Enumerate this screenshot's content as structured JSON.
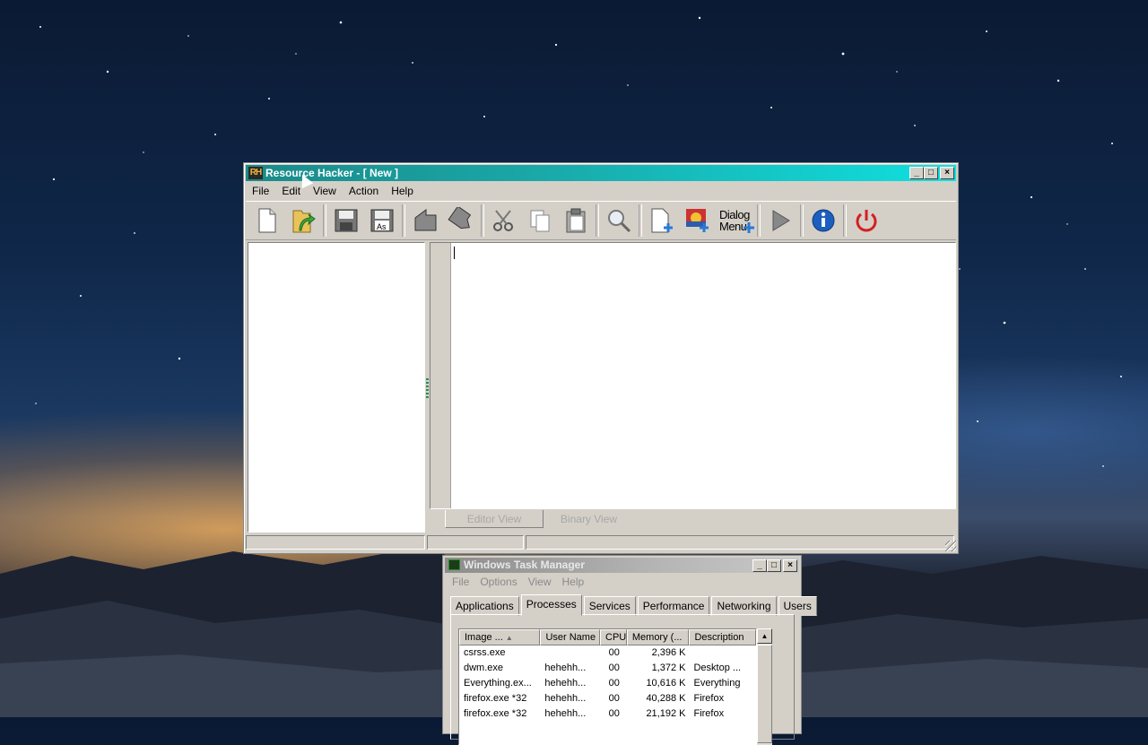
{
  "rh_window": {
    "app_icon_text": "RH",
    "title": "Resource Hacker - [ New ]",
    "window_buttons": {
      "minimize": "_",
      "maximize": "□",
      "close": "×"
    },
    "menu": [
      "File",
      "Edit",
      "View",
      "Action",
      "Help"
    ],
    "toolbar_icons": [
      "new-file-icon",
      "open-folder-icon",
      "save-icon",
      "save-as-icon",
      "compile-icon",
      "go-to-icon",
      "cut-icon",
      "copy-icon",
      "paste-icon",
      "find-icon",
      "add-resource-icon",
      "add-image-icon",
      "dialog-menu-icon",
      "run-script-icon",
      "about-icon",
      "exit-icon"
    ],
    "toolbar_texts": {
      "save_as": "As",
      "dialog": "Dialog",
      "menu": "Menu"
    },
    "tabs": {
      "editor_view": "Editor View",
      "binary_view": "Binary View"
    }
  },
  "task_manager": {
    "title": "Windows Task Manager",
    "window_buttons": {
      "minimize": "_",
      "maximize": "□",
      "close": "×"
    },
    "menu": [
      "File",
      "Options",
      "View",
      "Help"
    ],
    "tabs": [
      "Applications",
      "Processes",
      "Services",
      "Performance",
      "Networking",
      "Users"
    ],
    "active_tab": "Processes",
    "columns": [
      "Image ...",
      "User Name",
      "CPU",
      "Memory (...",
      "Description"
    ],
    "processes": [
      {
        "image": "csrss.exe",
        "user": "",
        "cpu": "00",
        "memory": "2,396 K",
        "description": ""
      },
      {
        "image": "dwm.exe",
        "user": "hehehh...",
        "cpu": "00",
        "memory": "1,372 K",
        "description": "Desktop ..."
      },
      {
        "image": "Everything.ex...",
        "user": "hehehh...",
        "cpu": "00",
        "memory": "10,616 K",
        "description": "Everything"
      },
      {
        "image": "firefox.exe *32",
        "user": "hehehh...",
        "cpu": "00",
        "memory": "40,288 K",
        "description": "Firefox"
      },
      {
        "image": "firefox.exe *32",
        "user": "hehehh...",
        "cpu": "00",
        "memory": "21,192 K",
        "description": "Firefox"
      }
    ]
  },
  "colors": {
    "rh_title_gradient_start": "#1a8a8a",
    "rh_title_gradient_end": "#10e0e0",
    "window_face": "#d4d0c8",
    "tm_title_inactive": "#b5b5b5"
  }
}
